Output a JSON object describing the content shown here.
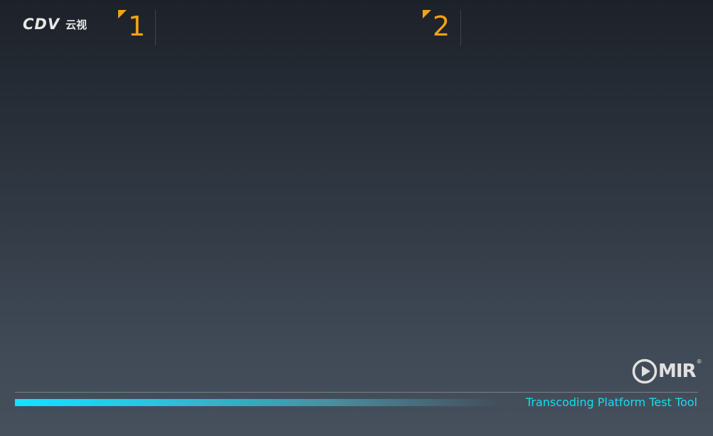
{
  "header": {
    "logo_latin": "CDV",
    "logo_chinese": "云视",
    "slots": [
      {
        "number": "1"
      },
      {
        "number": "2"
      }
    ]
  },
  "footer": {
    "brand_name": "MIR",
    "brand_mark": "®",
    "brand_icon": "play-circle-icon",
    "tagline": "Transcoding Platform Test Tool",
    "progress": 1.0
  },
  "colors": {
    "accent": "#f5a313",
    "tagline": "#17dcf0",
    "progress_start": "#10e4ff",
    "background_top": "#1d2129",
    "background_bottom": "#46505d"
  }
}
